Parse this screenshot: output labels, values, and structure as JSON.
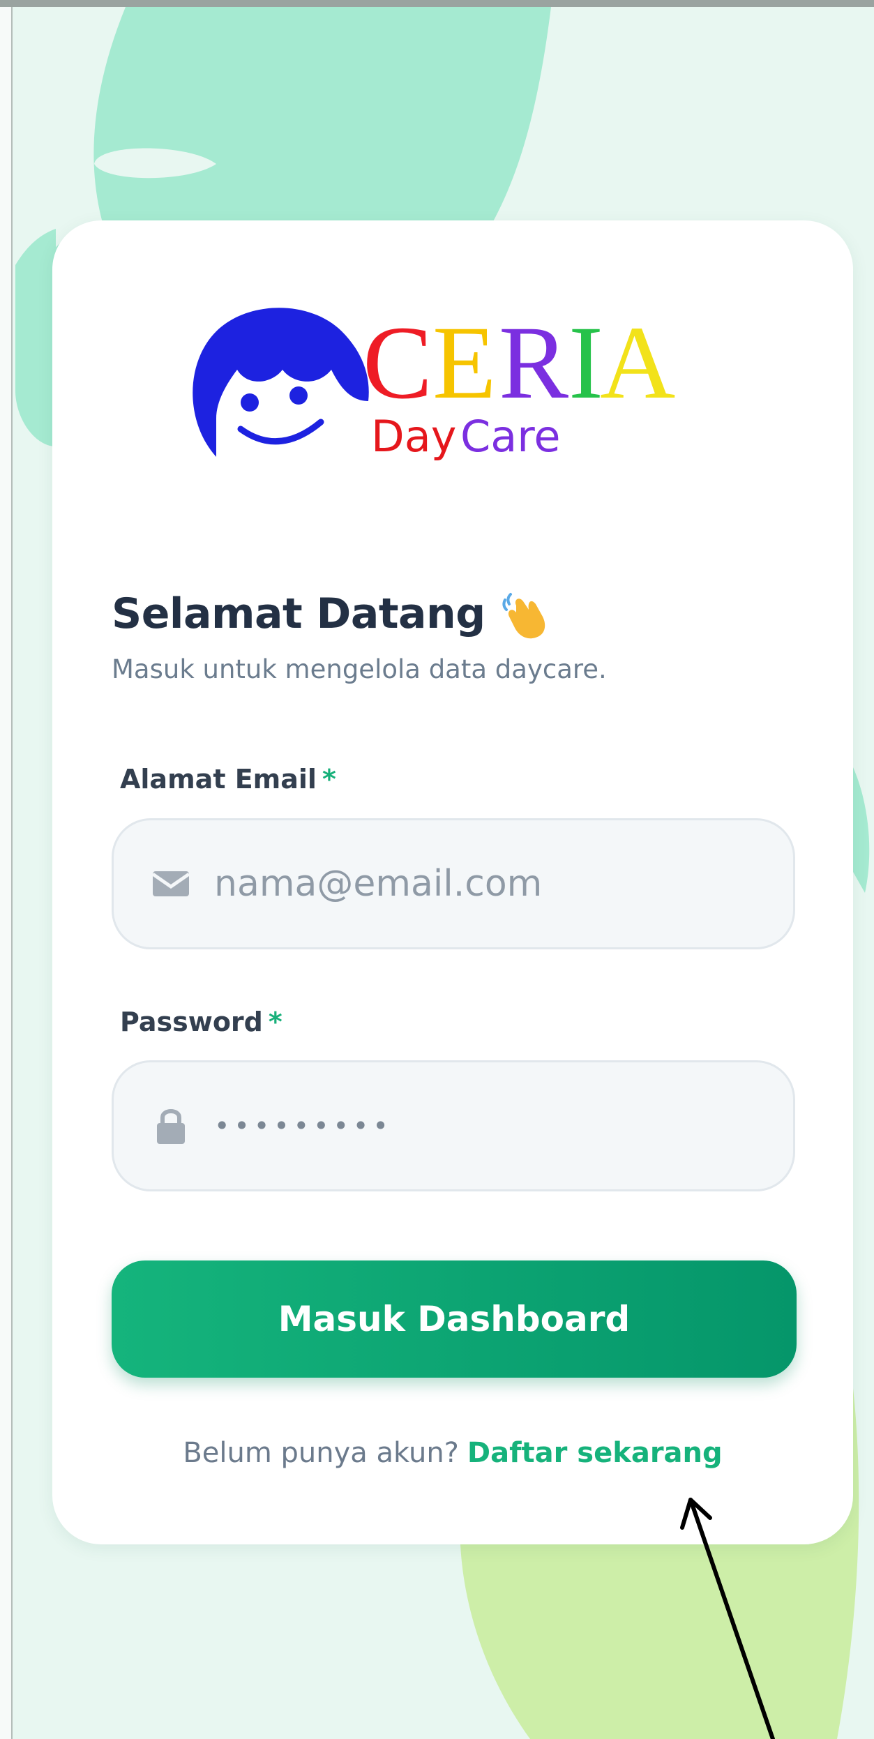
{
  "brand": {
    "logo_text": "CERIA",
    "logo_subtext_day": "Day",
    "logo_subtext_care": "Care",
    "colors": {
      "face": "#1d22e0",
      "C": "#ee1c25",
      "E": "#f6c400",
      "R": "#7b2fe0",
      "I": "#26c24a",
      "A": "#f2e21a",
      "day": "#e5171c",
      "care": "#7b2fe0"
    }
  },
  "welcome": {
    "title": "Selamat Datang",
    "subtitle": "Masuk untuk mengelola data daycare.",
    "icon": "waving-hand-icon"
  },
  "email": {
    "label": "Alamat Email",
    "required_mark": "*",
    "placeholder": "nama@email.com",
    "icon": "envelope-icon"
  },
  "password": {
    "label": "Password",
    "required_mark": "*",
    "masked_value": "•••••••••",
    "icon": "lock-icon"
  },
  "login_button": {
    "label": "Masuk Dashboard"
  },
  "register": {
    "question": "Belum punya akun?",
    "link": "Daftar sekarang"
  },
  "theme": {
    "accent": "#10a874",
    "background": "#e8f7f1"
  }
}
